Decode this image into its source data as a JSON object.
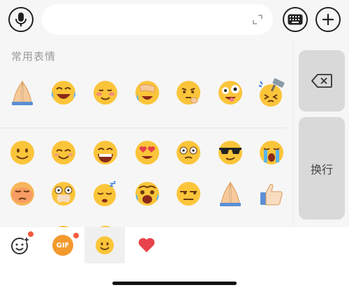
{
  "input": {
    "placeholder": ""
  },
  "emoji_panel": {
    "section_title": "常用表情",
    "frequent_row": [
      "folded-hands",
      "laughing-tears",
      "blush-shy",
      "facepalm-laugh",
      "thinking-chin",
      "crazy-silly",
      "hammer-hit"
    ],
    "grid_row_1": [
      "smile",
      "happy-smile",
      "grin",
      "heart-eyes",
      "surprised-flushed",
      "sunglasses-cool",
      "loud-crying"
    ],
    "grid_row_2": [
      "angry-red",
      "shushed-bandage",
      "sleepy-zzz",
      "scared-crying",
      "smirk-sideeye",
      "folded-hands",
      "thumbs-up"
    ]
  },
  "side_keys": {
    "delete_icon": "backspace-icon",
    "newline_label": "换行"
  },
  "tabs": [
    {
      "name": "emoji-add",
      "icon": "emoji-add-icon",
      "badge": true
    },
    {
      "name": "gif",
      "label": "GIF",
      "badge": true
    },
    {
      "name": "emoji",
      "icon": "yellow-face-icon",
      "selected": true
    },
    {
      "name": "favorites",
      "icon": "heart-icon"
    }
  ],
  "colors": {
    "background": "#f6f6f6",
    "key_gray": "#d9d9d9",
    "emoji_yellow": "#fbc53a",
    "gif_orange": "#f39a2d",
    "heart_red": "#e8424a",
    "badge_red": "#f25a3c"
  }
}
